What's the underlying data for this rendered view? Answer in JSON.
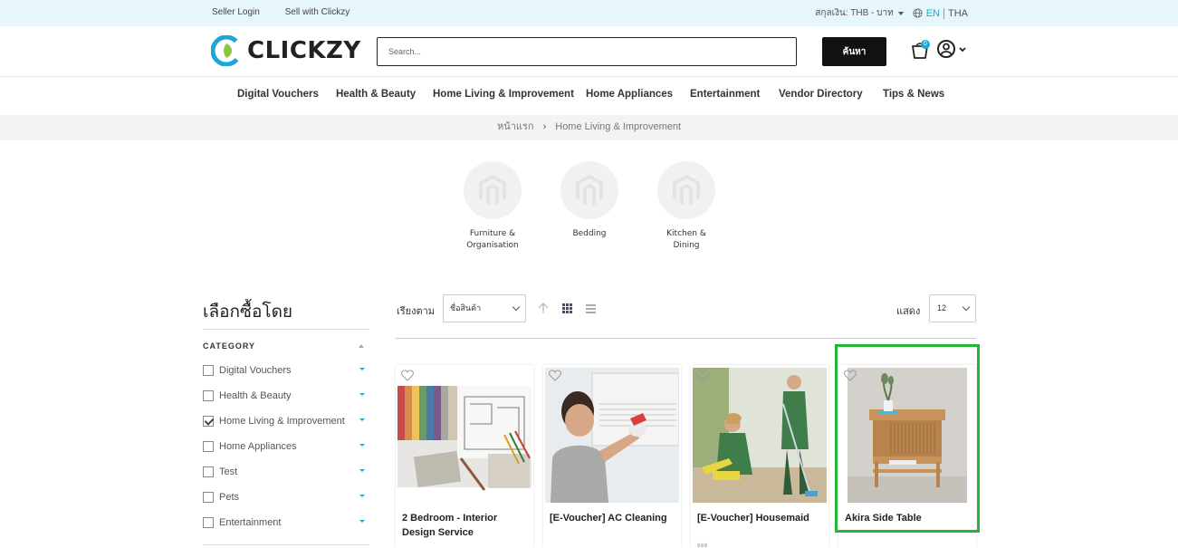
{
  "topbar": {
    "seller_login": "Seller Login",
    "sell_with": "Sell with Clickzy",
    "currency": "สกุลเงิน: THB - บาท",
    "lang_en": "EN",
    "lang_th": "THA"
  },
  "header": {
    "logo_text": "CLICKZY",
    "search_placeholder": "Search...",
    "search_button": "ค้นหา",
    "cart_count": "0"
  },
  "nav": [
    "Digital Vouchers",
    "Health & Beauty",
    "Home Living & Improvement",
    "Home Appliances",
    "Entertainment",
    "Vendor Directory",
    "Tips & News"
  ],
  "breadcrumb": {
    "home": "หน้าแรก",
    "current": "Home Living & Improvement"
  },
  "subcategories": [
    {
      "line1": "Furniture &",
      "line2": "Organisation"
    },
    {
      "line1": "Bedding",
      "line2": ""
    },
    {
      "line1": "Kitchen &",
      "line2": "Dining"
    }
  ],
  "sidebar": {
    "title": "เลือกซื้อโดย",
    "category_heading": "CATEGORY",
    "categories": [
      {
        "label": "Digital Vouchers",
        "checked": false
      },
      {
        "label": "Health & Beauty",
        "checked": false
      },
      {
        "label": "Home Living & Improvement",
        "checked": true
      },
      {
        "label": "Home Appliances",
        "checked": false
      },
      {
        "label": "Test",
        "checked": false
      },
      {
        "label": "Pets",
        "checked": false
      },
      {
        "label": "Entertainment",
        "checked": false
      }
    ]
  },
  "toolbar": {
    "sort_label": "เรียงตาม",
    "sort_value": "ชื่อสินค้า",
    "show_label": "แสดง",
    "show_value": "12"
  },
  "products": [
    {
      "name": "2 Bedroom - Interior Design Service"
    },
    {
      "name": "[E-Voucher] AC Cleaning"
    },
    {
      "name": "[E-Voucher] Housemaid"
    },
    {
      "name": "Akira Side Table"
    }
  ],
  "colors": {
    "accent": "#1ea7d6",
    "logo_green": "#8cc63f",
    "highlight": "#22b53a"
  }
}
